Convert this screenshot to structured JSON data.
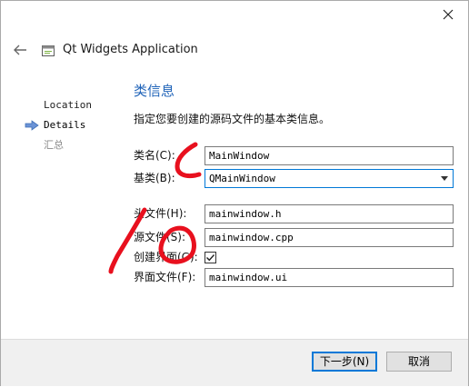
{
  "window": {
    "title": "Qt Widgets Application",
    "close_icon": "close-icon",
    "back_icon": "back-arrow-icon",
    "app_icon": "qt-app-icon"
  },
  "steps": [
    {
      "label": "Location",
      "state": "done"
    },
    {
      "label": "Details",
      "state": "current"
    },
    {
      "label": "汇总",
      "state": "future"
    }
  ],
  "page": {
    "title": "类信息",
    "description": "指定您要创建的源码文件的基本类信息。"
  },
  "form": {
    "class_name": {
      "label": "类名(C):",
      "value": "MainWindow"
    },
    "base_class": {
      "label": "基类(B):",
      "value": "QMainWindow",
      "options_visible": [
        "QMainWindow"
      ]
    },
    "header_file": {
      "label": "头文件(H):",
      "value": "mainwindow.h"
    },
    "source_file": {
      "label": "源文件(S):",
      "value": "mainwindow.cpp"
    },
    "generate_form": {
      "label": "创建界面(G):",
      "checked": true
    },
    "form_file": {
      "label": "界面文件(F):",
      "value": "mainwindow.ui"
    }
  },
  "buttons": {
    "next": "下一步(N)",
    "cancel": "取消"
  },
  "colors": {
    "title_blue": "#1f63b8",
    "focus_blue": "#0078d7",
    "annotation_red": "#e8101e",
    "step_arrow": "#6b93d6"
  }
}
